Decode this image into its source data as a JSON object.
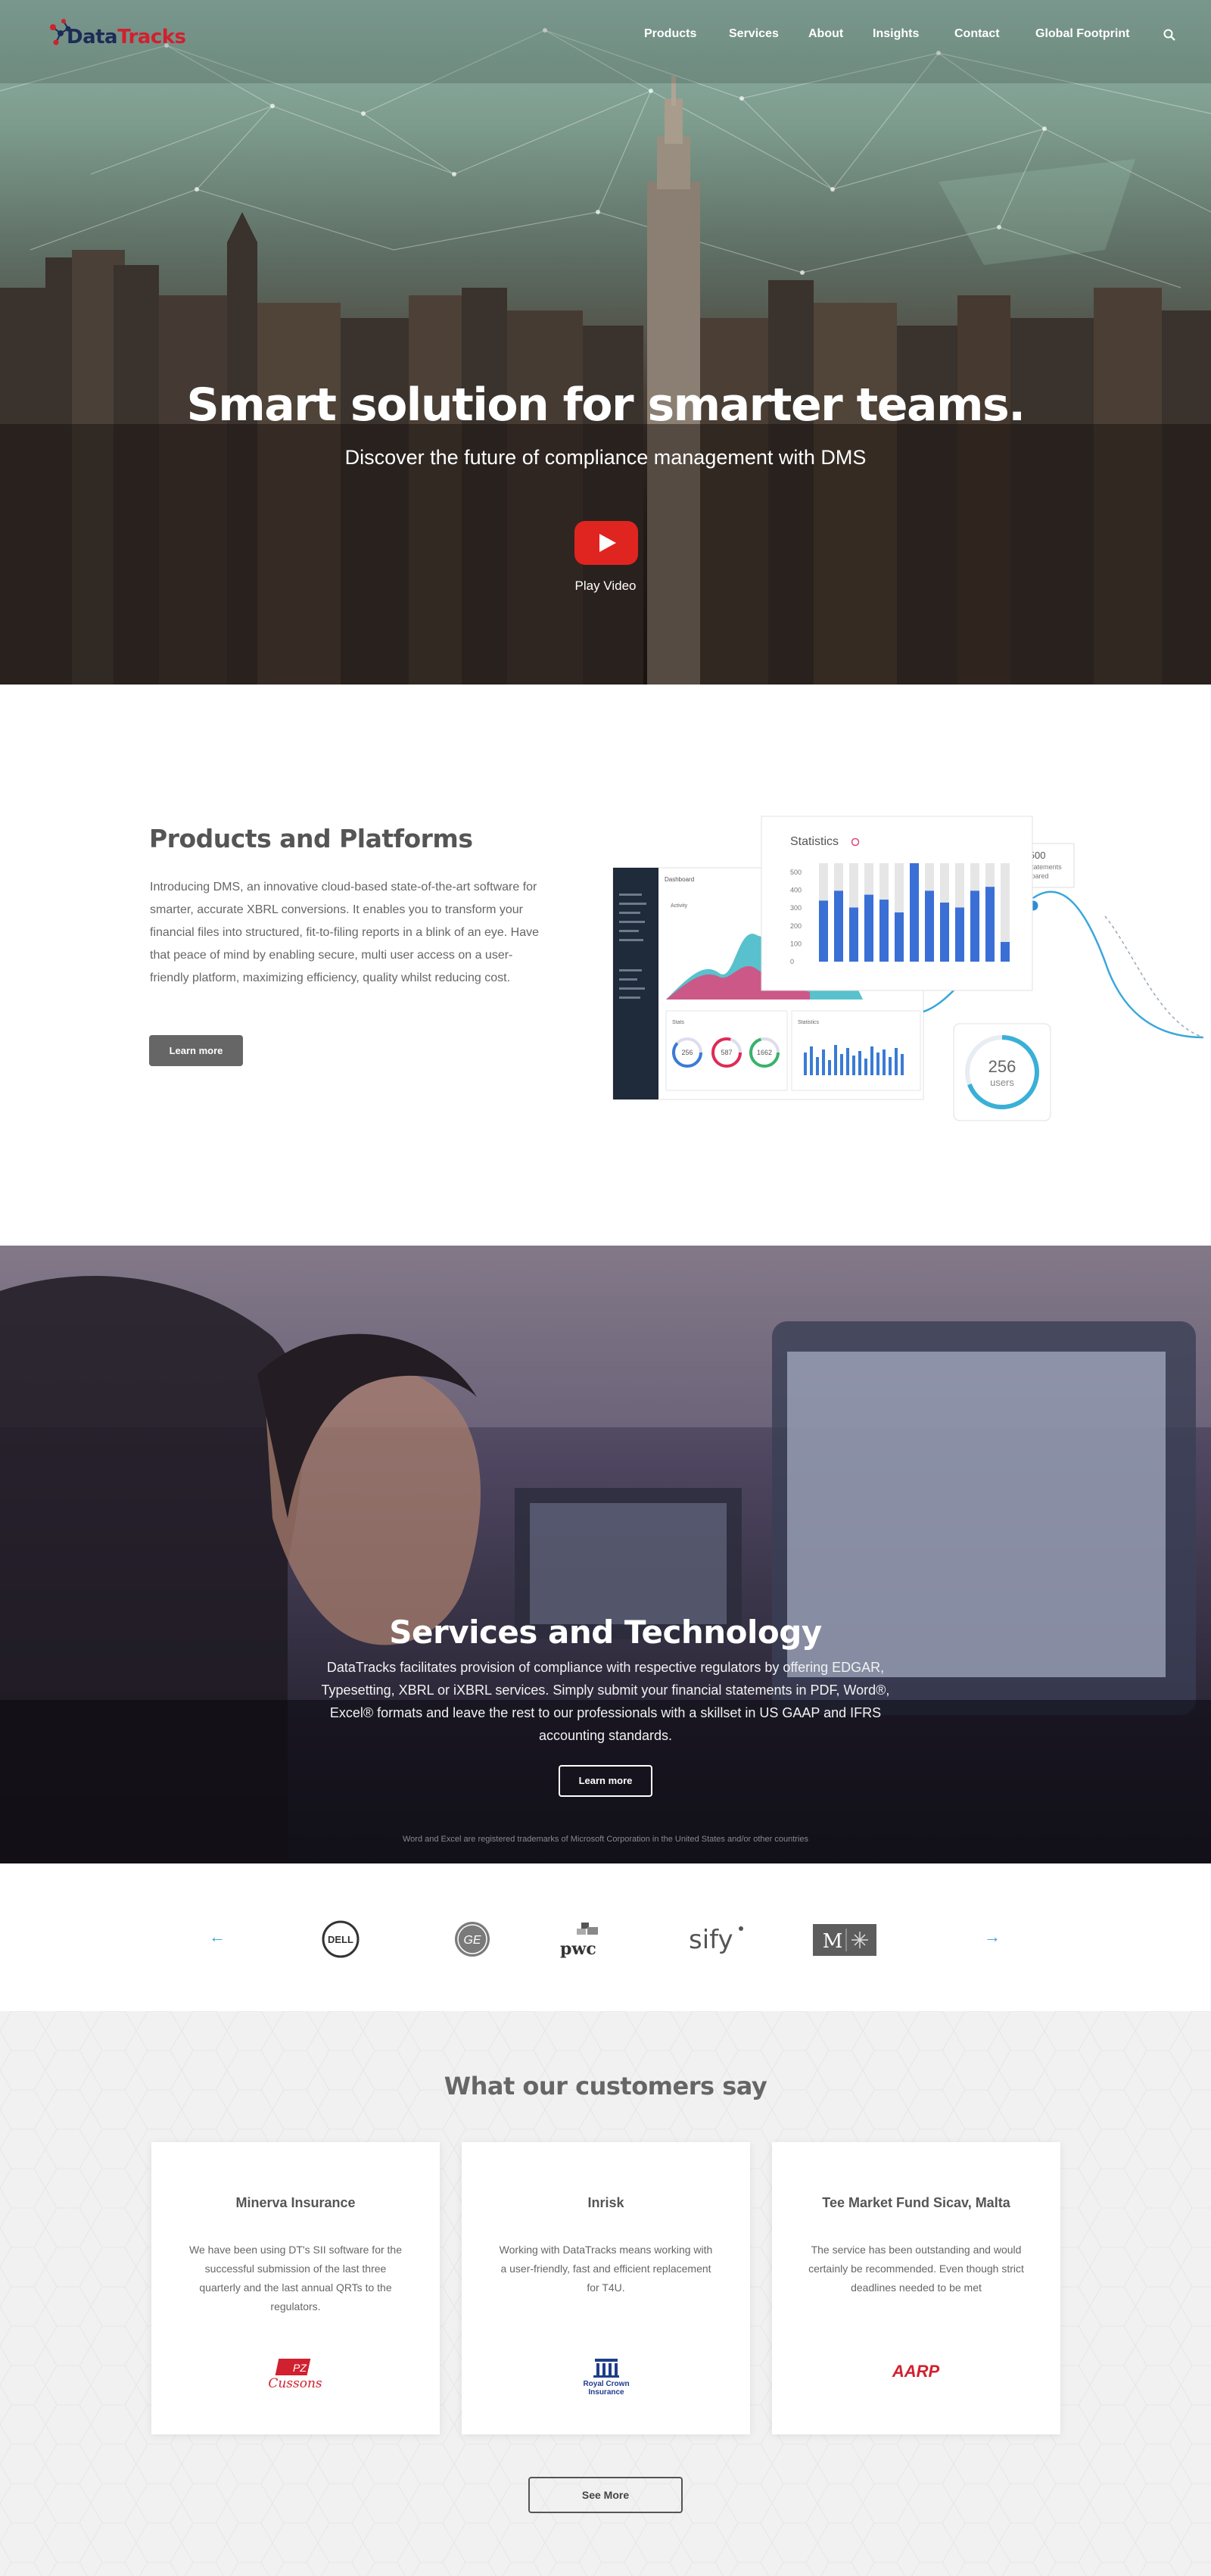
{
  "nav": {
    "logo_part1": "Data",
    "logo_part2": "Tracks",
    "items": [
      "Products",
      "Services",
      "About",
      "Insights",
      "Contact",
      "Global Footprint"
    ],
    "search_icon": "search-icon"
  },
  "hero": {
    "title": "Smart solution for smarter teams.",
    "subtitle": "Discover the future of compliance management with DMS",
    "play_label": "Play Video"
  },
  "products": {
    "title": "Products and Platforms",
    "text": "Introducing DMS, an innovative cloud-based state-of-the-art software for smarter, accurate XBRL conversions. It enables you to transform your financial files into structured, fit-to-filing reports in a blink of an eye. Have that peace of mind by enabling secure, multi user access on a user-friendly platform, maximizing efficiency, quality whilst reducing cost.",
    "button": "Learn more",
    "mockup": {
      "stats_title": "Statistics",
      "stats_axis": [
        "500",
        "400",
        "300",
        "200",
        "100",
        "0"
      ],
      "stats_bars": [
        0.62,
        0.72,
        0.55,
        0.68,
        0.63,
        0.5,
        1.0,
        0.72,
        0.6,
        0.55,
        0.72,
        0.76,
        0.2
      ],
      "tooltip_value": "2500",
      "tooltip_label_1": "XBRL Statements",
      "tooltip_label_2": "Prepared",
      "users_value": "256",
      "users_label": "users",
      "dash_title": "Dashboard",
      "dash_activity": "Activity",
      "dash_stats": "Stats",
      "dash_statistics": "Statistics",
      "dash_circle_1": "256",
      "dash_circle_2": "587",
      "dash_circle_3": "1662"
    }
  },
  "services": {
    "title": "Services and Technology",
    "text": "DataTracks facilitates provision of compliance with respective regulators by offering EDGAR, Typesetting, XBRL or iXBRL services. Simply submit your financial statements in PDF, Word®, Excel® formats and leave the rest to our professionals with a skillset in US GAAP and IFRS accounting standards.",
    "button": "Learn more",
    "note": "Word and Excel are registered trademarks of Microsoft Corporation in the United States and/or other countries"
  },
  "clients": {
    "prev": "←",
    "next": "→",
    "logos": [
      "DELL",
      "GE",
      "pwc",
      "sify",
      "M"
    ]
  },
  "testimonials": {
    "title": "What our customers say",
    "cards": [
      {
        "name": "Minerva Insurance",
        "text": "We have been using DT's SII software for the successful submission of the last three quarterly and the last annual QRTs to the regulators.",
        "logo_a": "PZ",
        "logo_b": "Cussons"
      },
      {
        "name": "Inrisk",
        "text": "Working with DataTracks means working with a user-friendly, fast and efficient replacement for T4U.",
        "logo_a": "Royal Crown",
        "logo_b": "Insurance"
      },
      {
        "name": "Tee Market Fund Sicav, Malta",
        "text": "The service has been outstanding and would certainly be recommended. Even though strict deadlines needed to be met",
        "logo_a": "AARP",
        "logo_b": ""
      }
    ],
    "button": "See More"
  },
  "colors": {
    "brand_navy": "#1d2b56",
    "brand_red": "#d1202f",
    "accent_blue": "#3a7bd5",
    "play_red": "#e02420"
  }
}
